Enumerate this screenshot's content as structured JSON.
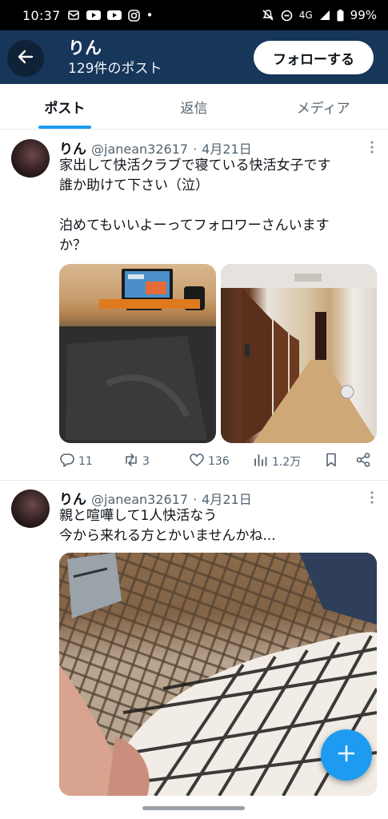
{
  "status_bar": {
    "time": "10:37",
    "network": "4G",
    "battery": "99%",
    "dot": "•",
    "left_icons": [
      "notification-icon",
      "youtube-icon",
      "youtube-icon",
      "instagram-icon"
    ],
    "right_icons": [
      "mute-icon",
      "dnd-icon",
      "signal-icon",
      "battery-icon"
    ]
  },
  "header": {
    "name": "りん",
    "post_count": "129件のポスト",
    "follow_label": "フォローする"
  },
  "tabs": [
    {
      "label": "ポスト",
      "active": true
    },
    {
      "label": "返信",
      "active": false
    },
    {
      "label": "メディア",
      "active": false
    }
  ],
  "posts": [
    {
      "name": "りん",
      "handle": "@janean32617",
      "sep": "·",
      "date": "4月21日",
      "text": "家出して快活クラブで寝ている快活女子です\n誰か助けて下さい（泣）\n\n泊めてもいいよーってフォロワーさんいます\nか？",
      "replies": "11",
      "reposts": "3",
      "likes": "136",
      "views": "1.2万"
    },
    {
      "name": "りん",
      "handle": "@janean32617",
      "sep": "·",
      "date": "4月21日",
      "text": "親と喧嘩して1人快活なう\n今から来れる方とかいませんかね..."
    }
  ],
  "colors": {
    "header_bg": "#16365a",
    "accent": "#1d9bf0",
    "secondary_text": "#536471"
  },
  "fab": {
    "icon": "plus-icon"
  }
}
